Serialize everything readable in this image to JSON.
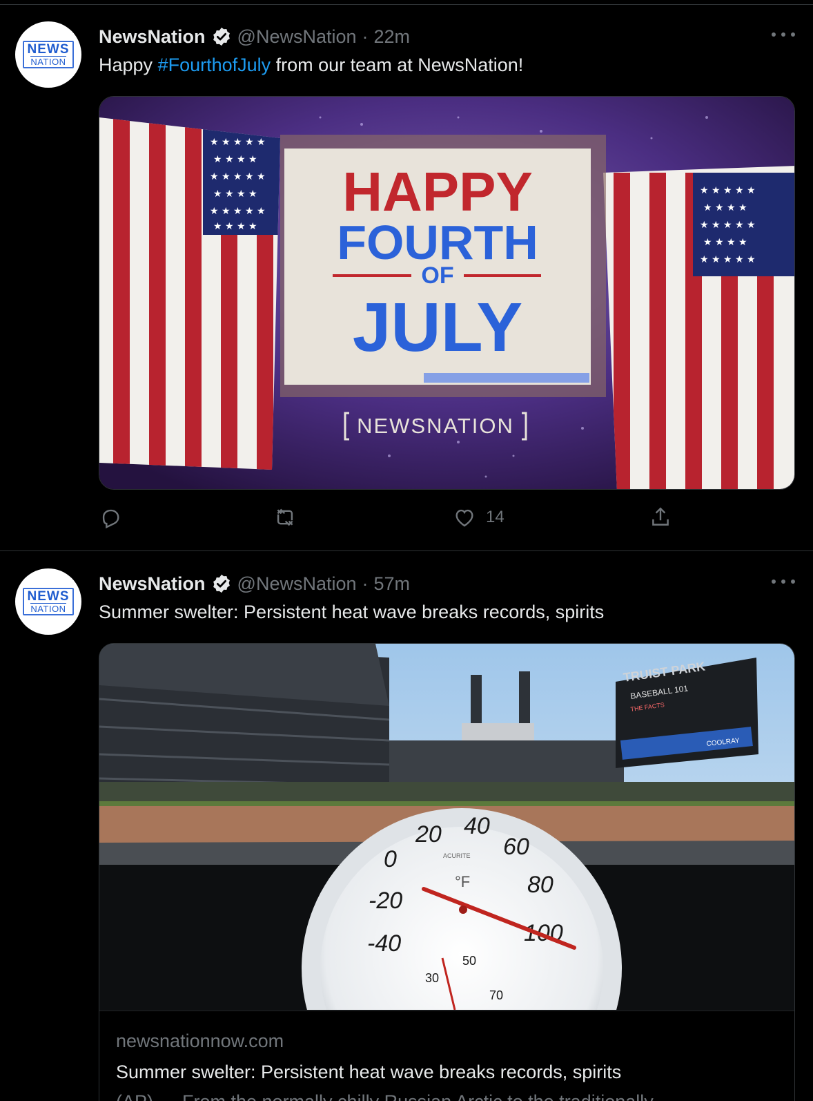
{
  "tweets": [
    {
      "author_name": "NewsNation",
      "handle": "@NewsNation",
      "separator": "·",
      "time": "22m",
      "text_prefix": "Happy ",
      "hashtag": "#FourthofJuly",
      "text_suffix": " from our team at NewsNation!",
      "image": {
        "line1": "HAPPY",
        "line2": "FOURTH",
        "line3": "OF",
        "line4": "JULY",
        "brand": "NEWSNATION"
      },
      "like_count": "14"
    },
    {
      "author_name": "NewsNation",
      "handle": "@NewsNation",
      "separator": "·",
      "time": "57m",
      "text": "Summer swelter: Persistent heat wave breaks records, spirits",
      "card": {
        "domain": "newsnationnow.com",
        "title": "Summer swelter: Persistent heat wave breaks records, spirits",
        "description": "(AP) — From the normally chilly Russian Arctic to the traditionally",
        "image": {
          "scoreboard_title": "TRUIST PARK",
          "scoreboard_line": "BASEBALL 101",
          "scoreboard_sub": "THE FACTS",
          "sponsor": "COOLRAY",
          "gauge_unit": "°F",
          "gauge_brand": "ACURITE",
          "outer_ticks": [
            "-40",
            "-20",
            "0",
            "20",
            "40",
            "60",
            "80",
            "100"
          ],
          "inner_ticks": [
            "30",
            "50",
            "70"
          ]
        }
      }
    }
  ],
  "avatar": {
    "line1": "NEWS",
    "line2": "NATION"
  },
  "icons": [
    "verified-badge-icon",
    "more-icon",
    "reply-icon",
    "retweet-icon",
    "like-icon",
    "share-icon"
  ],
  "colors": {
    "accent": "#1d9bf0",
    "muted": "#71767b",
    "text": "#e7e9ea",
    "border": "#2f3336"
  }
}
